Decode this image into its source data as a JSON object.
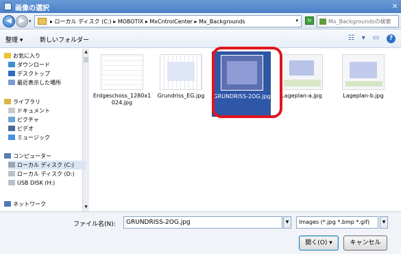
{
  "window": {
    "title": "画像の選択",
    "close_glyph": "×"
  },
  "address": {
    "path": "▸ ローカル ディスク (C:) ▸ MOBOTIX ▸ MxCntrolCenter ▸ Mx_Backgrounds",
    "search_placeholder": "Mx_Backgroundsの検索"
  },
  "toolbar": {
    "organize_label": "整理 ▾",
    "new_folder_label": "新しいフォルダー"
  },
  "nav": {
    "items": [
      {
        "label": "お気に入り",
        "icon": "star-icon",
        "color": "#f1c232",
        "sub": false
      },
      {
        "label": "ダウンロード",
        "icon": "download-icon",
        "color": "#3d8fd1",
        "sub": true
      },
      {
        "label": "デスクトップ",
        "icon": "desktop-icon",
        "color": "#2d6cbf",
        "sub": true
      },
      {
        "label": "最近表示した場所",
        "icon": "recent-places-icon",
        "color": "#7d9ccf",
        "sub": true
      },
      {
        "label": "ライブラリ",
        "icon": "library-icon",
        "color": "#d9b24a",
        "sub": false
      },
      {
        "label": "ドキュメント",
        "icon": "documents-icon",
        "color": "#c9c9c9",
        "sub": true
      },
      {
        "label": "ピクチャ",
        "icon": "pictures-icon",
        "color": "#6aa4d8",
        "sub": true
      },
      {
        "label": "ビデオ",
        "icon": "videos-icon",
        "color": "#4b6a94",
        "sub": true
      },
      {
        "label": "ミュージック",
        "icon": "music-icon",
        "color": "#4a90e2",
        "sub": true
      },
      {
        "label": "コンピューター",
        "icon": "computer-icon",
        "color": "#5b7fb0",
        "sub": false
      },
      {
        "label": "ローカル ディスク (C:)",
        "icon": "drive-icon",
        "color": "#9aa7b6",
        "sub": true
      },
      {
        "label": "ローカル ディスク (D:)",
        "icon": "drive-icon",
        "color": "#b9c1cc",
        "sub": true
      },
      {
        "label": "USB DISK (H:)",
        "icon": "usb-drive-icon",
        "color": "#b9c1cc",
        "sub": true
      },
      {
        "label": "ネットワーク",
        "icon": "network-icon",
        "color": "#4e78b0",
        "sub": false
      }
    ]
  },
  "files": [
    {
      "name": "Erdgeschoss_1280x1024.jpg",
      "selected": false
    },
    {
      "name": "Grundriss_EG.jpg",
      "selected": false
    },
    {
      "name": "GRUNDRISS-2OG.jpg",
      "selected": true
    },
    {
      "name": "Lageplan-a.jpg",
      "selected": false
    },
    {
      "name": "Lageplan-b.jpg",
      "selected": false
    }
  ],
  "bottom": {
    "filename_label": "ファイル名(N):",
    "filename_value": "GRUNDRISS-2OG.jpg",
    "filter_value": "Images (*.jpg *.bmp *.gif)",
    "open_label": "開く(O)  ▾",
    "cancel_label": "キャンセル"
  },
  "colors": {
    "highlight": "#e0151d",
    "selection": "#2f57a8"
  }
}
